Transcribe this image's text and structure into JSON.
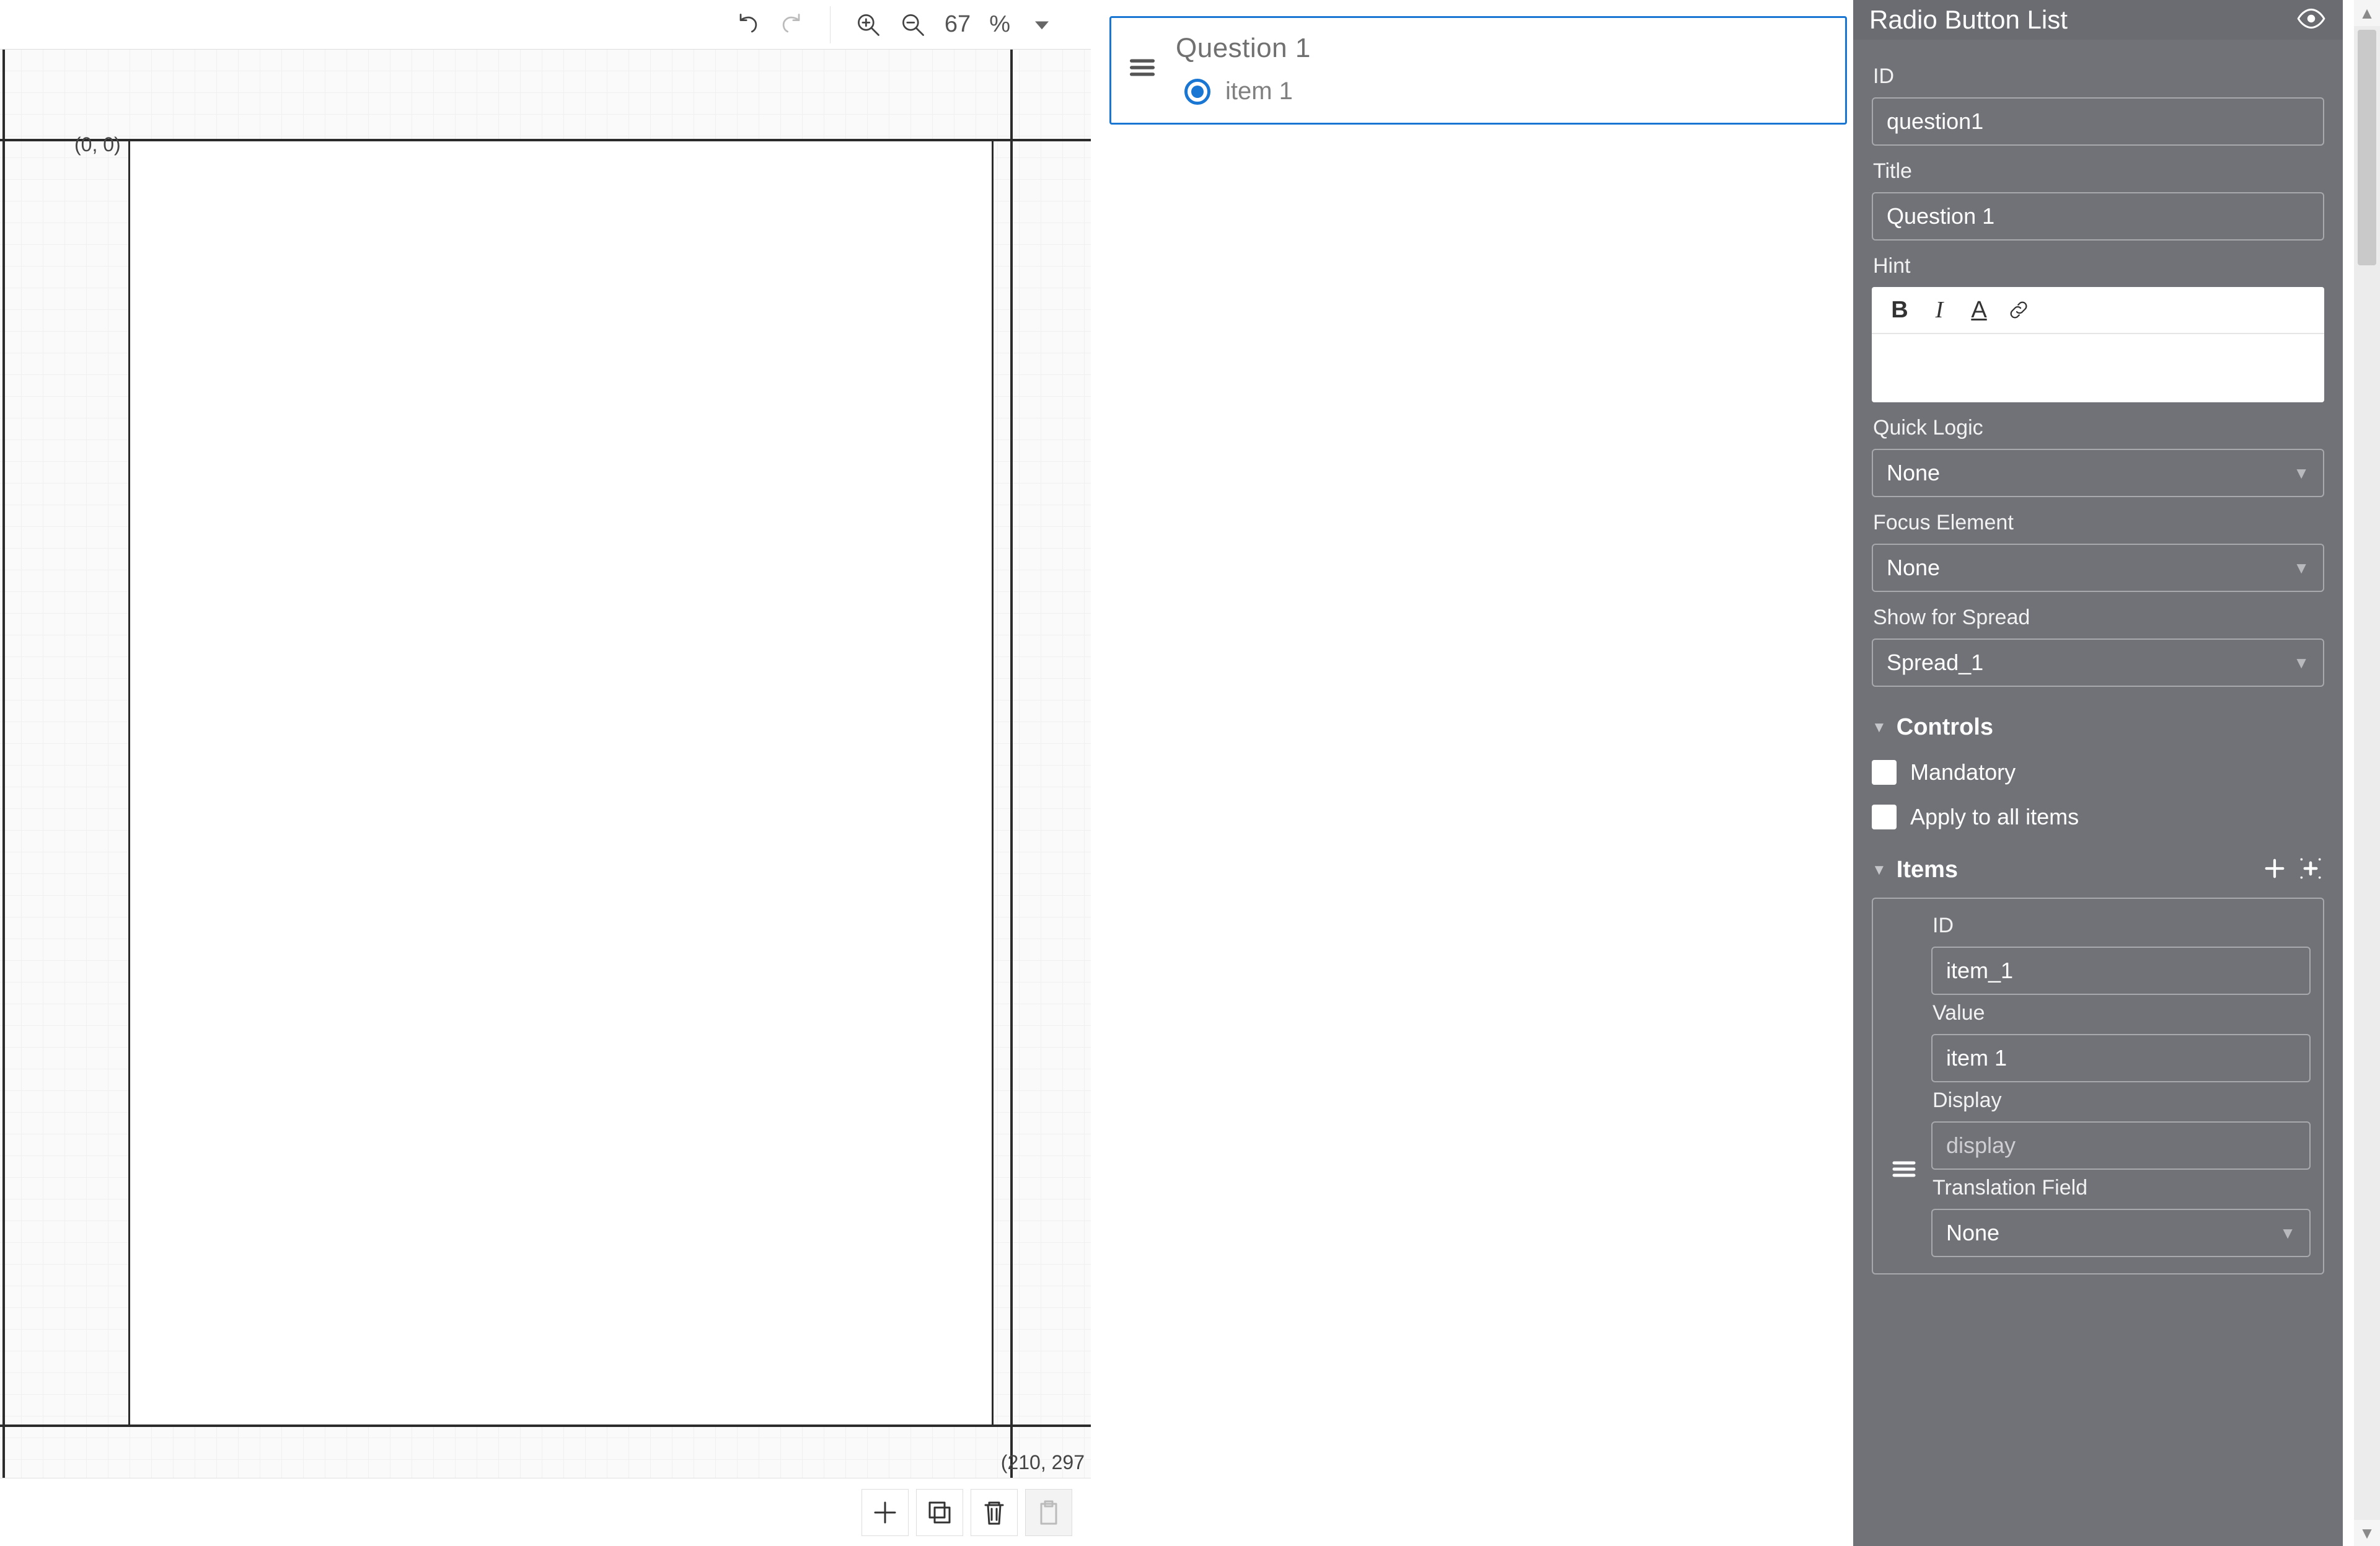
{
  "canvas": {
    "zoom_value": "67",
    "zoom_unit": "%",
    "origin_label": "(0, 0)",
    "extent_label": "(210, 297"
  },
  "question_card": {
    "title": "Question 1",
    "items": [
      {
        "label": "item 1",
        "selected": true
      }
    ]
  },
  "props": {
    "panel_title": "Radio Button List",
    "id_label": "ID",
    "id_value": "question1",
    "title_label": "Title",
    "title_value": "Question 1",
    "hint_label": "Hint",
    "quick_logic_label": "Quick Logic",
    "quick_logic_value": "None",
    "focus_label": "Focus Element",
    "focus_value": "None",
    "spread_label": "Show for Spread",
    "spread_value": "Spread_1",
    "controls_section": "Controls",
    "mandatory_label": "Mandatory",
    "apply_all_label": "Apply to all items",
    "items_section": "Items",
    "item": {
      "id_label": "ID",
      "id_value": "item_1",
      "value_label": "Value",
      "value_value": "item 1",
      "display_label": "Display",
      "display_placeholder": "display",
      "translation_label": "Translation Field",
      "translation_value": "None"
    }
  }
}
